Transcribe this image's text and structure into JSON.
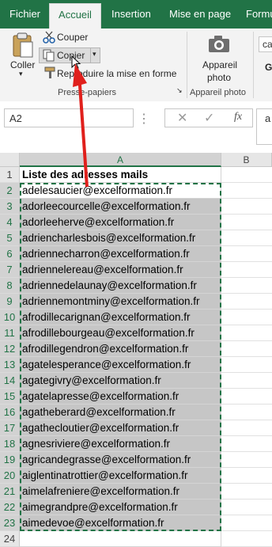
{
  "tabs": [
    "Fichier",
    "Accueil",
    "Insertion",
    "Mise en page",
    "Formu"
  ],
  "ribbon": {
    "paste_label": "Coller",
    "cut_label": "Couper",
    "copy_label": "Copier",
    "format_painter_label": "Reproduire la mise en forme",
    "clipboard_group": "Presse-papiers",
    "camera_label_1": "Appareil",
    "camera_label_2": "photo",
    "camera_group": "Appareil photo",
    "font_box_text": "ca"
  },
  "formula_bar": {
    "name_box": "A2",
    "fx_symbol": "fx",
    "content": "a"
  },
  "columns": [
    "A",
    "B"
  ],
  "rows": [
    {
      "n": "1",
      "text": "Liste des adresses mails"
    },
    {
      "n": "2",
      "text": "adelesaucier@excelformation.fr"
    },
    {
      "n": "3",
      "text": "adorleecourcelle@excelformation.fr"
    },
    {
      "n": "4",
      "text": "adorleeherve@excelformation.fr"
    },
    {
      "n": "5",
      "text": "adriencharlesbois@excelformation.fr"
    },
    {
      "n": "6",
      "text": "adriennecharron@excelformation.fr"
    },
    {
      "n": "7",
      "text": "adriennelereau@excelformation.fr"
    },
    {
      "n": "8",
      "text": "adriennedelaunay@excelformation.fr"
    },
    {
      "n": "9",
      "text": "adriennemontminy@excelformation.fr"
    },
    {
      "n": "10",
      "text": "afrodillecarignan@excelformation.fr"
    },
    {
      "n": "11",
      "text": "afrodillebourgeau@excelformation.fr"
    },
    {
      "n": "12",
      "text": "afrodillegendron@excelformation.fr"
    },
    {
      "n": "13",
      "text": "agatelesperance@excelformation.fr"
    },
    {
      "n": "14",
      "text": "agategivry@excelformation.fr"
    },
    {
      "n": "15",
      "text": "agatelapresse@excelformation.fr"
    },
    {
      "n": "16",
      "text": "agatheberard@excelformation.fr"
    },
    {
      "n": "17",
      "text": "agathecloutier@excelformation.fr"
    },
    {
      "n": "18",
      "text": "agnesriviere@excelformation.fr"
    },
    {
      "n": "19",
      "text": "agricandegrasse@excelformation.fr"
    },
    {
      "n": "20",
      "text": "aiglentinatrottier@excelformation.fr"
    },
    {
      "n": "21",
      "text": "aimelafreniere@excelformation.fr"
    },
    {
      "n": "22",
      "text": "aimegrandpre@excelformation.fr"
    },
    {
      "n": "23",
      "text": "aimedevoe@excelformation.fr"
    },
    {
      "n": "24",
      "text": ""
    }
  ],
  "colors": {
    "accent": "#217346",
    "selection": "#c6c6c6",
    "arrow": "#e0201c"
  }
}
